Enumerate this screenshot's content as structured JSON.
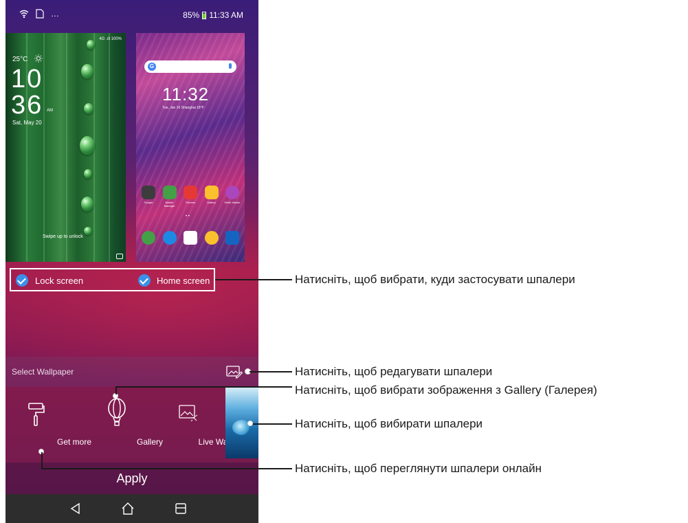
{
  "status_bar": {
    "battery_percent": "85%",
    "time": "11:33 AM",
    "left_icons": [
      "wifi-icon",
      "sim-card-icon",
      "more-icon"
    ]
  },
  "lock_preview": {
    "signal_text": "4G .ıll 100%",
    "temperature": "25°C",
    "hour": "10",
    "minute": "36",
    "ampm": "AM",
    "date": "Sat, May 20",
    "swipe_hint": "Swipe up to unlock"
  },
  "home_preview": {
    "clock": "11:32",
    "date": "Tue, Jan 16  Shanghai  18°F",
    "apps_row1": [
      "Google",
      "Mobile Manager",
      "Themes",
      "Gallery",
      "Selfie Master"
    ],
    "apps_row1_colors": [
      "#3c3c3c",
      "#43a047",
      "#e53935",
      "#fbc02d",
      "#ab47bc"
    ],
    "apps_row2_colors": [
      "#43a047",
      "#1e88e5",
      "#ffffff",
      "#fbc02d",
      "#1565c0"
    ]
  },
  "screen_selector": {
    "lock_label": "Lock screen",
    "home_label": "Home screen"
  },
  "select_wallpaper": {
    "title": "Select Wallpaper"
  },
  "options": {
    "get_more": "Get more",
    "gallery": "Gallery",
    "live_wallpaper": "Live Wallpaper"
  },
  "apply": "Apply",
  "callouts": {
    "select_target": "Натисніть, щоб вибрати, куди застосувати шпалери",
    "edit": "Натисніть, щоб редагувати шпалери",
    "gallery": "Натисніть, щоб вибрати зображення з Gallery (Галерея)",
    "choose": "Натисніть, щоб вибирати шпалери",
    "online": "Натисніть, щоб переглянути шпалери онлайн"
  }
}
